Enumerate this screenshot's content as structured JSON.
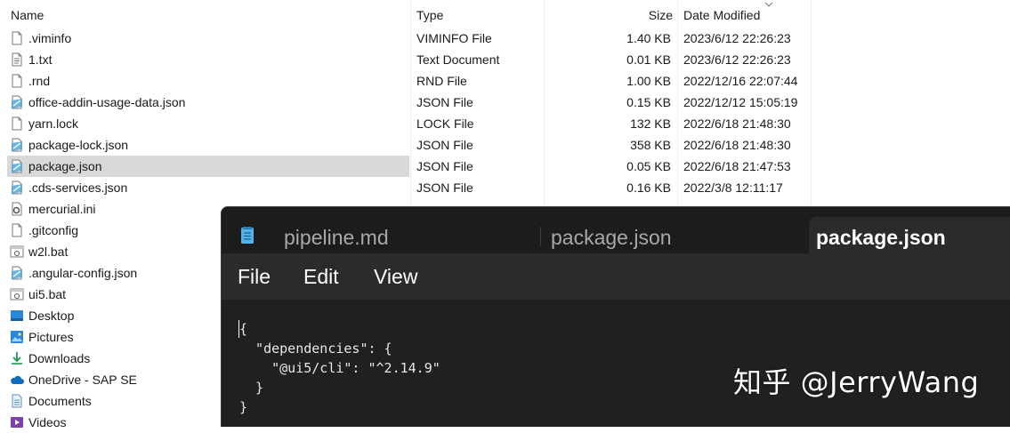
{
  "explorer": {
    "columns": {
      "name": "Name",
      "type": "Type",
      "size": "Size",
      "date": "Date Modified"
    },
    "files": [
      {
        "name": ".viminfo",
        "type": "VIMINFO File",
        "size": "1.40 KB",
        "date": "2023/6/12 22:26:23",
        "icon": "blank-file-icon"
      },
      {
        "name": "1.txt",
        "type": "Text Document",
        "size": "0.01 KB",
        "date": "2023/6/12 22:26:23",
        "icon": "text-file-icon"
      },
      {
        "name": ".rnd",
        "type": "RND File",
        "size": "1.00 KB",
        "date": "2022/12/16 22:07:44",
        "icon": "blank-file-icon"
      },
      {
        "name": "office-addin-usage-data.json",
        "type": "JSON File",
        "size": "0.15 KB",
        "date": "2022/12/12 15:05:19",
        "icon": "json-file-icon"
      },
      {
        "name": "yarn.lock",
        "type": "LOCK File",
        "size": "132 KB",
        "date": "2022/6/18 21:48:30",
        "icon": "blank-file-icon"
      },
      {
        "name": "package-lock.json",
        "type": "JSON File",
        "size": "358 KB",
        "date": "2022/6/18 21:48:30",
        "icon": "json-file-icon"
      },
      {
        "name": "package.json",
        "type": "JSON File",
        "size": "0.05 KB",
        "date": "2022/6/18 21:47:53",
        "icon": "json-file-icon",
        "selected": true
      },
      {
        "name": ".cds-services.json",
        "type": "JSON File",
        "size": "0.16 KB",
        "date": "2022/3/8 12:11:17",
        "icon": "json-file-icon"
      },
      {
        "name": "mercurial.ini",
        "type": "",
        "size": "",
        "date": "",
        "icon": "settings-file-icon"
      },
      {
        "name": ".gitconfig",
        "type": "",
        "size": "",
        "date": "",
        "icon": "blank-file-icon"
      },
      {
        "name": "w2l.bat",
        "type": "",
        "size": "",
        "date": "",
        "icon": "batch-file-icon"
      },
      {
        "name": ".angular-config.json",
        "type": "",
        "size": "",
        "date": "",
        "icon": "json-file-icon"
      },
      {
        "name": "ui5.bat",
        "type": "",
        "size": "",
        "date": "",
        "icon": "batch-file-icon"
      },
      {
        "name": "Desktop",
        "type": "",
        "size": "",
        "date": "",
        "icon": "desktop-folder-icon"
      },
      {
        "name": "Pictures",
        "type": "",
        "size": "",
        "date": "",
        "icon": "pictures-folder-icon"
      },
      {
        "name": "Downloads",
        "type": "",
        "size": "",
        "date": "",
        "icon": "downloads-folder-icon"
      },
      {
        "name": "OneDrive - SAP SE",
        "type": "",
        "size": "",
        "date": "",
        "icon": "onedrive-cloud-icon"
      },
      {
        "name": "Documents",
        "type": "",
        "size": "",
        "date": "",
        "icon": "documents-folder-icon"
      },
      {
        "name": "Videos",
        "type": "",
        "size": "",
        "date": "",
        "icon": "videos-folder-icon"
      }
    ]
  },
  "notepad": {
    "tabs": [
      {
        "label": "pipeline.md",
        "active": false
      },
      {
        "label": "package.json",
        "active": false
      },
      {
        "label": "package.json",
        "active": true
      }
    ],
    "menu": {
      "file": "File",
      "edit": "Edit",
      "view": "View"
    },
    "content": "{\n  \"dependencies\": {\n    \"@ui5/cli\": \"^2.14.9\"\n  }\n}"
  },
  "watermark": "知乎 @JerryWang",
  "colors": {
    "selected_row": "#d9d9d9",
    "notepad_bg": "#202020",
    "tab_active": "#2b2b2b"
  }
}
